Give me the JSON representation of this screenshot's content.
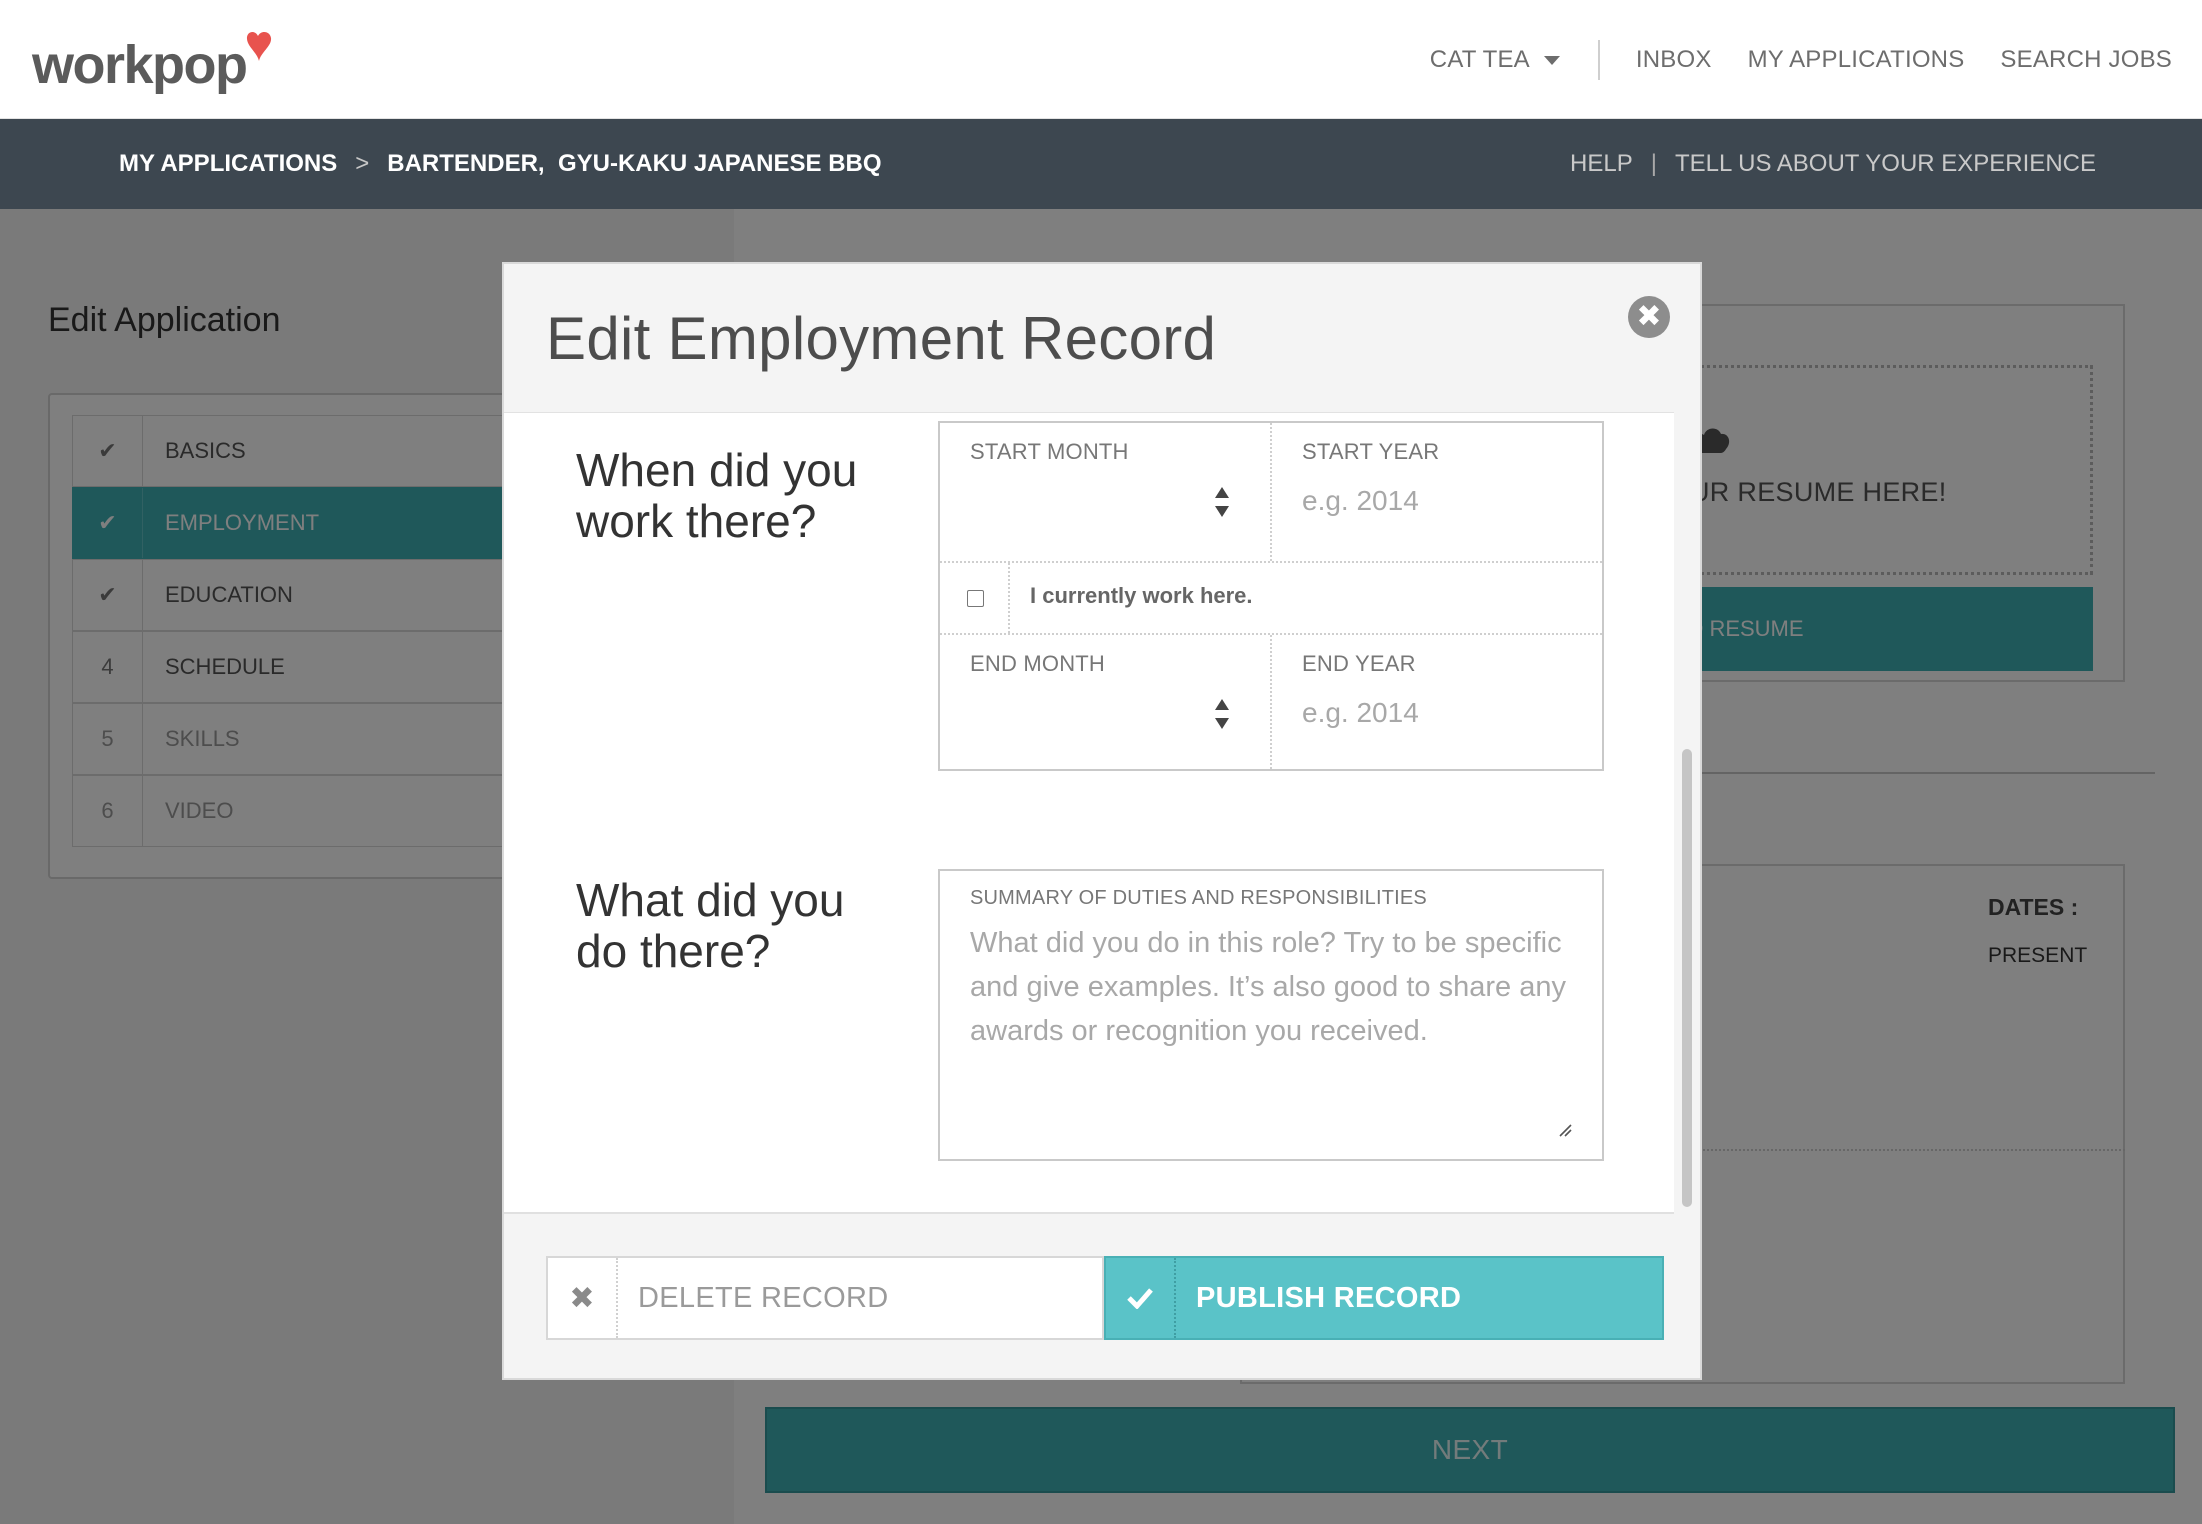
{
  "header": {
    "logo": "workpop",
    "user_menu": "CAT TEA",
    "nav": [
      "INBOX",
      "MY APPLICATIONS",
      "SEARCH JOBS"
    ]
  },
  "breadcrumb": {
    "root": "MY APPLICATIONS",
    "separator": ">",
    "current": "BARTENDER,  GYU-KAKU JAPANESE BBQ",
    "help": "HELP",
    "pipe": "|",
    "feedback": "TELL US ABOUT YOUR EXPERIENCE"
  },
  "sidebar": {
    "title": "Edit Application",
    "steps": [
      {
        "num": "✔",
        "label": "BASICS"
      },
      {
        "num": "✔",
        "label": "EMPLOYMENT"
      },
      {
        "num": "✔",
        "label": "EDUCATION"
      },
      {
        "num": "4",
        "label": "SCHEDULE"
      },
      {
        "num": "5",
        "label": "SKILLS"
      },
      {
        "num": "6",
        "label": "VIDEO"
      }
    ]
  },
  "background": {
    "resume_drop_text": "UR RESUME HERE!",
    "resume_button": "D RESUME",
    "dates_label": "DATES :",
    "present": "PRESENT",
    "next_button": "NEXT"
  },
  "modal": {
    "title": "Edit Employment Record",
    "close_glyph": "✖",
    "when_question": "When did you work there?",
    "start_month_label": "START MONTH",
    "start_year_label": "START YEAR",
    "start_year_placeholder": "e.g. 2014",
    "current_work_label": "I currently work here.",
    "end_month_label": "END MONTH",
    "end_year_label": "END YEAR",
    "end_year_placeholder": "e.g. 2014",
    "what_question": "What did you do there?",
    "summary_label": "SUMMARY OF DUTIES AND RESPONSIBILITIES",
    "summary_placeholder": "What did you do in this role? Try to be specific and give examples. It’s also good to share any awards or recognition you received.",
    "delete_glyph": "✖",
    "delete_label": "DELETE RECORD",
    "publish_label": "PUBLISH RECORD"
  },
  "colors": {
    "accent": "#3fb1b5",
    "publish": "#5ac3c8",
    "header_bar": "#3d4750",
    "logo_heart": "#e8534e"
  },
  "icons": [
    "caret-down-icon",
    "checkmark-icon",
    "cloud-upload-icon",
    "close-icon",
    "updown-arrows-icon",
    "resize-grip-icon",
    "x-icon"
  ]
}
